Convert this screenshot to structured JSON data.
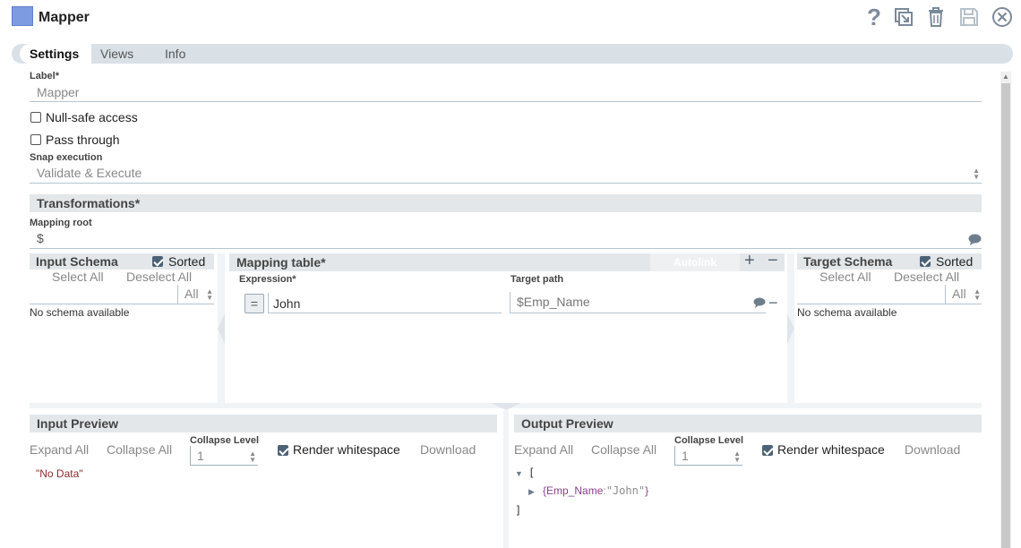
{
  "header": {
    "title": "Mapper",
    "icons": [
      "help-icon",
      "export-icon",
      "delete-icon",
      "save-icon",
      "close-icon"
    ]
  },
  "tabs": [
    {
      "label": "Settings",
      "active": true
    },
    {
      "label": "Views",
      "active": false
    },
    {
      "label": "Info",
      "active": false
    }
  ],
  "settings": {
    "label_caption": "Label*",
    "label_value": "Mapper",
    "null_safe_label": "Null-safe access",
    "null_safe_checked": false,
    "pass_through_label": "Pass through",
    "pass_through_checked": false,
    "snap_execution_caption": "Snap execution",
    "snap_execution_value": "Validate & Execute"
  },
  "transformations": {
    "title": "Transformations*",
    "mapping_root_caption": "Mapping root",
    "mapping_root_value": "$"
  },
  "input_schema": {
    "title": "Input Schema",
    "sorted_label": "Sorted",
    "sorted_checked": true,
    "select_all": "Select All",
    "deselect_all": "Deselect All",
    "filter_value": "All",
    "empty_text": "No schema available"
  },
  "mapping_table": {
    "title": "Mapping table*",
    "autolink": "Autolink",
    "expression_header": "Expression*",
    "target_header": "Target path",
    "rows": [
      {
        "expression": "John",
        "target": "$Emp_Name"
      }
    ]
  },
  "target_schema": {
    "title": "Target Schema",
    "sorted_label": "Sorted",
    "sorted_checked": true,
    "select_all": "Select All",
    "deselect_all": "Deselect All",
    "filter_value": "All",
    "empty_text": "No schema available"
  },
  "input_preview": {
    "title": "Input Preview",
    "expand_all": "Expand All",
    "collapse_all": "Collapse All",
    "collapse_level_caption": "Collapse Level",
    "collapse_level_value": "1",
    "render_whitespace_label": "Render whitespace",
    "render_whitespace_checked": true,
    "download": "Download",
    "content": "\"No Data\""
  },
  "output_preview": {
    "title": "Output Preview",
    "expand_all": "Expand All",
    "collapse_all": "Collapse All",
    "collapse_level_caption": "Collapse Level",
    "collapse_level_value": "1",
    "render_whitespace_label": "Render whitespace",
    "render_whitespace_checked": true,
    "download": "Download",
    "json_open": "[",
    "json_close": "]",
    "json_obj_open": "{",
    "json_key": "Emp_Name",
    "json_colon": ":",
    "json_value": "\"John\"",
    "json_obj_close": "}"
  },
  "colors": {
    "accent": "#7d9be0",
    "section_bg": "#e3e7ea",
    "json_key": "#8a3e8a",
    "json_string": "#8c8c8c",
    "no_data": "#8b2d2d"
  }
}
